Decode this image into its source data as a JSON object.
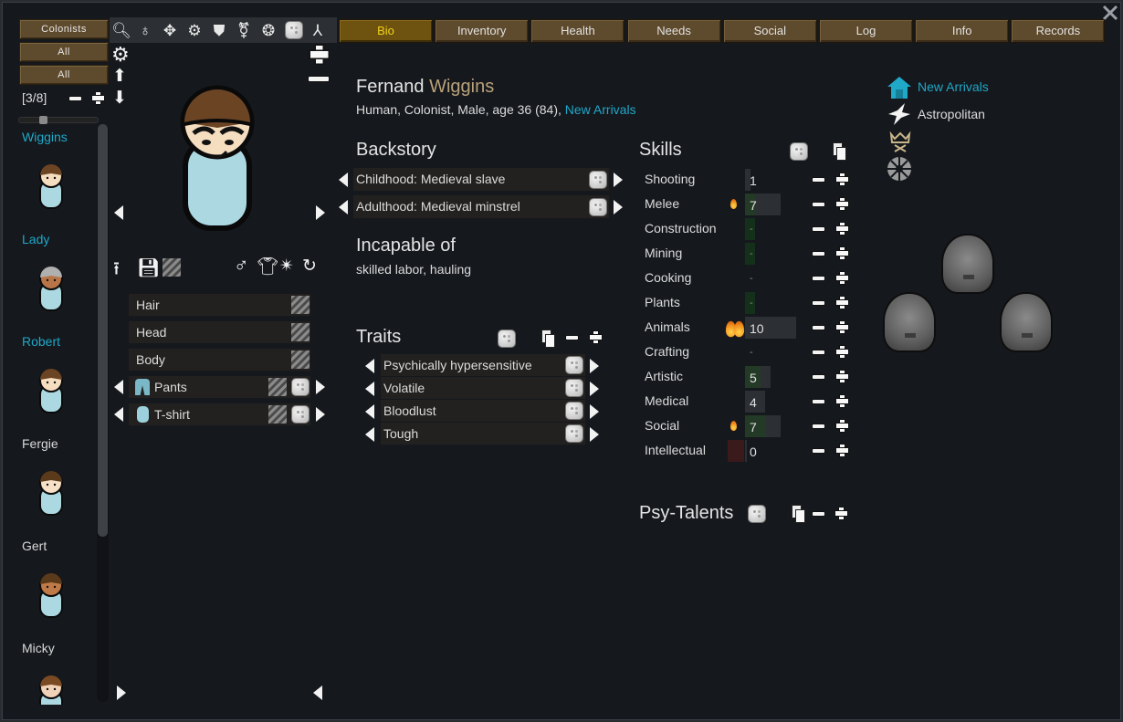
{
  "window": {
    "close_icon": "close-icon"
  },
  "filters": {
    "colonists": "Colonists",
    "filter1": "All",
    "filter2": "All",
    "counter": "[3/8]"
  },
  "toolbar_icons": [
    "search-icon",
    "pawn-pair-icon",
    "faction-wings-icon",
    "gears-icon",
    "shield-icon",
    "gender-icon",
    "globe-icon",
    "randomize-die-icon",
    "split-icon"
  ],
  "tabs": [
    {
      "label": "Bio",
      "active": true
    },
    {
      "label": "Inventory"
    },
    {
      "label": "Health"
    },
    {
      "label": "Needs"
    },
    {
      "label": "Social"
    },
    {
      "label": "Log"
    },
    {
      "label": "Info"
    },
    {
      "label": "Records"
    }
  ],
  "sidebar": {
    "pawns": [
      {
        "name": "Wiggins",
        "selected_style": true
      },
      {
        "name": "Lady",
        "selected_style": true
      },
      {
        "name": "Robert",
        "selected_style": true
      },
      {
        "name": "Fergie"
      },
      {
        "name": "Gert"
      },
      {
        "name": "Micky"
      }
    ]
  },
  "appearance": {
    "rows": [
      {
        "label": "Hair"
      },
      {
        "label": "Head"
      },
      {
        "label": "Body"
      },
      {
        "label": "Pants",
        "icon": "pants-icon"
      },
      {
        "label": "T-shirt",
        "icon": "tshirt-icon"
      }
    ]
  },
  "bio": {
    "first_name": "Fernand",
    "last_name": "Wiggins",
    "description": "Human, Colonist, Male, age 36 (84),",
    "faction_link": "New Arrivals",
    "backstory_title": "Backstory",
    "childhood": "Childhood: Medieval slave",
    "adulthood": "Adulthood: Medieval minstrel",
    "incapable_title": "Incapable of",
    "incapable_list": "skilled labor, hauling",
    "traits_title": "Traits",
    "traits": [
      "Psychically hypersensitive",
      "Volatile",
      "Bloodlust",
      "Tough"
    ],
    "psy_title": "Psy-Talents"
  },
  "skills": {
    "title": "Skills",
    "items": [
      {
        "name": "Shooting",
        "value": "1",
        "level": 1,
        "passion": 0,
        "disabled": false
      },
      {
        "name": "Melee",
        "value": "7",
        "level": 7,
        "passion": 1,
        "disabled": false
      },
      {
        "name": "Construction",
        "value": "-",
        "level": 0,
        "passion": 0,
        "disabled": true
      },
      {
        "name": "Mining",
        "value": "-",
        "level": 0,
        "passion": 0,
        "disabled": true
      },
      {
        "name": "Cooking",
        "value": "-",
        "level": 0,
        "passion": 0,
        "disabled": true
      },
      {
        "name": "Plants",
        "value": "-",
        "level": 0,
        "passion": 0,
        "disabled": true
      },
      {
        "name": "Animals",
        "value": "10",
        "level": 10,
        "passion": 2,
        "disabled": false
      },
      {
        "name": "Crafting",
        "value": "-",
        "level": 0,
        "passion": 0,
        "disabled": true
      },
      {
        "name": "Artistic",
        "value": "5",
        "level": 5,
        "passion": 0,
        "disabled": false
      },
      {
        "name": "Medical",
        "value": "4",
        "level": 4,
        "passion": 0,
        "disabled": false
      },
      {
        "name": "Social",
        "value": "7",
        "level": 7,
        "passion": 1,
        "disabled": false
      },
      {
        "name": "Intellectual",
        "value": "0",
        "level": 0,
        "passion": 0,
        "disabled": false
      }
    ]
  },
  "info_panel": {
    "faction": "New Arrivals",
    "ideology": "Astropolitan",
    "faction_color": "#1fa8c8"
  },
  "colors": {
    "accent": "#1fa8c8",
    "tab_active_text": "#f1d11a",
    "surname": "#b9a27a",
    "background": "#15181d"
  }
}
